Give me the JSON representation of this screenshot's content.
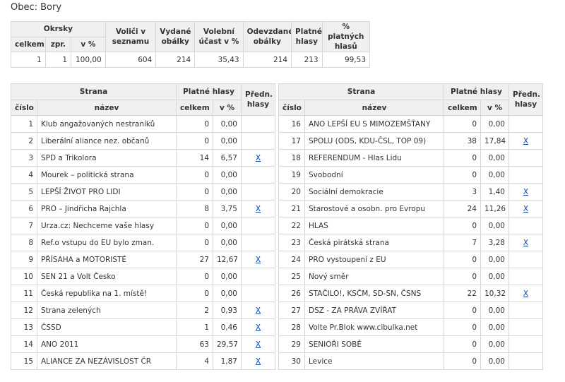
{
  "title": "Obec: Bory",
  "summary": {
    "headers": {
      "okrsky": "Okrsky",
      "celkem": "celkem",
      "zpr": "zpr.",
      "v_pct": "v %",
      "volici": "Voliči v seznamu",
      "vydane": "Vydané obálky",
      "ucast": "Volební účast v %",
      "odevzdane": "Odevzdané obálky",
      "platne": "Platné hlasy",
      "pct_platnych": "% platných hlasů"
    },
    "row": {
      "celkem": "1",
      "zpr": "1",
      "v_pct": "100,00",
      "volici": "604",
      "vydane": "214",
      "ucast": "35,43",
      "odevzdane": "214",
      "platne": "213",
      "pct_platnych": "99,53"
    }
  },
  "party_headers": {
    "strana": "Strana",
    "platne_hlasy": "Platné hlasy",
    "predn": "Předn. hlasy",
    "cislo": "číslo",
    "nazev": "název",
    "celkem": "celkem",
    "v_pct": "v %"
  },
  "parties_left": [
    {
      "cislo": "1",
      "nazev": "Klub angažovaných nestraníků",
      "celkem": "0",
      "pct": "0,00",
      "predn": ""
    },
    {
      "cislo": "2",
      "nazev": "Liberální aliance nez. občanů",
      "celkem": "0",
      "pct": "0,00",
      "predn": ""
    },
    {
      "cislo": "3",
      "nazev": "SPD a Trikolora",
      "celkem": "14",
      "pct": "6,57",
      "predn": "X"
    },
    {
      "cislo": "4",
      "nazev": "Mourek – politická strana",
      "celkem": "0",
      "pct": "0,00",
      "predn": ""
    },
    {
      "cislo": "5",
      "nazev": "LEPŠÍ ŽIVOT PRO LIDI",
      "celkem": "0",
      "pct": "0,00",
      "predn": ""
    },
    {
      "cislo": "6",
      "nazev": "PRO – Jindřicha Rajchla",
      "celkem": "8",
      "pct": "3,75",
      "predn": "X"
    },
    {
      "cislo": "7",
      "nazev": "Urza.cz: Nechceme vaše hlasy",
      "celkem": "0",
      "pct": "0,00",
      "predn": ""
    },
    {
      "cislo": "8",
      "nazev": "Ref.o vstupu do EU bylo zman.",
      "celkem": "0",
      "pct": "0,00",
      "predn": ""
    },
    {
      "cislo": "9",
      "nazev": "PŘÍSAHA a MOTORISTÉ",
      "celkem": "27",
      "pct": "12,67",
      "predn": "X"
    },
    {
      "cislo": "10",
      "nazev": "SEN 21 a Volt Česko",
      "celkem": "0",
      "pct": "0,00",
      "predn": ""
    },
    {
      "cislo": "11",
      "nazev": "Česká republika na 1. místě!",
      "celkem": "0",
      "pct": "0,00",
      "predn": ""
    },
    {
      "cislo": "12",
      "nazev": "Strana zelených",
      "celkem": "2",
      "pct": "0,93",
      "predn": "X"
    },
    {
      "cislo": "13",
      "nazev": "ČSSD",
      "celkem": "1",
      "pct": "0,46",
      "predn": "X"
    },
    {
      "cislo": "14",
      "nazev": "ANO 2011",
      "celkem": "63",
      "pct": "29,57",
      "predn": "X"
    },
    {
      "cislo": "15",
      "nazev": "ALIANCE ZA NEZÁVISLOST ČR",
      "celkem": "4",
      "pct": "1,87",
      "predn": "X"
    }
  ],
  "parties_right": [
    {
      "cislo": "16",
      "nazev": "ANO LEPŠÍ EU S MIMOZEMŠŤANY",
      "celkem": "0",
      "pct": "0,00",
      "predn": ""
    },
    {
      "cislo": "17",
      "nazev": "SPOLU (ODS, KDU-ČSL, TOP 09)",
      "celkem": "38",
      "pct": "17,84",
      "predn": "X"
    },
    {
      "cislo": "18",
      "nazev": "REFERENDUM - Hlas Lidu",
      "celkem": "0",
      "pct": "0,00",
      "predn": ""
    },
    {
      "cislo": "19",
      "nazev": "Svobodní",
      "celkem": "0",
      "pct": "0,00",
      "predn": ""
    },
    {
      "cislo": "20",
      "nazev": "Sociální demokracie",
      "celkem": "3",
      "pct": "1,40",
      "predn": "X"
    },
    {
      "cislo": "21",
      "nazev": "Starostové a osobn. pro Evropu",
      "celkem": "24",
      "pct": "11,26",
      "predn": "X"
    },
    {
      "cislo": "22",
      "nazev": "HLAS",
      "celkem": "0",
      "pct": "0,00",
      "predn": ""
    },
    {
      "cislo": "23",
      "nazev": "Česká pirátská strana",
      "celkem": "7",
      "pct": "3,28",
      "predn": "X"
    },
    {
      "cislo": "24",
      "nazev": "PRO vystoupení z EU",
      "celkem": "0",
      "pct": "0,00",
      "predn": ""
    },
    {
      "cislo": "25",
      "nazev": "Nový směr",
      "celkem": "0",
      "pct": "0,00",
      "predn": ""
    },
    {
      "cislo": "26",
      "nazev": "STAČILO!, KSČM, SD-SN, ČSNS",
      "celkem": "22",
      "pct": "10,32",
      "predn": "X"
    },
    {
      "cislo": "27",
      "nazev": "DSZ - ZA PRÁVA ZVÍŘAT",
      "celkem": "0",
      "pct": "0,00",
      "predn": ""
    },
    {
      "cislo": "28",
      "nazev": "Volte Pr.Blok www.cibulka.net",
      "celkem": "0",
      "pct": "0,00",
      "predn": ""
    },
    {
      "cislo": "29",
      "nazev": "SENIOŘI SOBĚ",
      "celkem": "0",
      "pct": "0,00",
      "predn": ""
    },
    {
      "cislo": "30",
      "nazev": "Levice",
      "celkem": "0",
      "pct": "0,00",
      "predn": ""
    }
  ]
}
